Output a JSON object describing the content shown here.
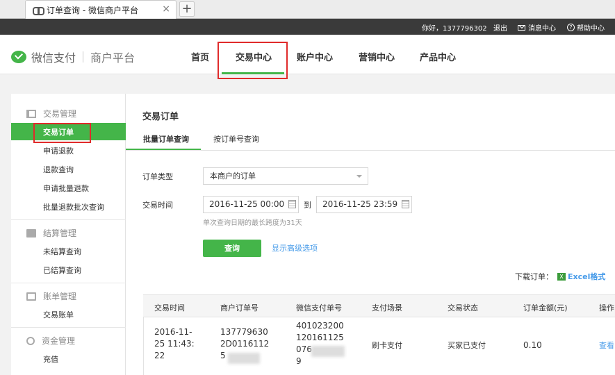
{
  "browser": {
    "tab_title": "订单查询 - 微信商户平台",
    "close_glyph": "×",
    "new_tab_glyph": "+"
  },
  "topbar": {
    "greeting": "你好，1377796302",
    "logout": "退出",
    "messages": "消息中心",
    "help": "帮助中心"
  },
  "header": {
    "brand": "微信支付",
    "platform": "商户平台",
    "nav": [
      "首页",
      "交易中心",
      "账户中心",
      "营销中心",
      "产品中心"
    ],
    "active_nav": "交易中心"
  },
  "sidebar": {
    "groups": [
      {
        "title": "交易管理",
        "items": [
          "交易订单",
          "申请退款",
          "退款查询",
          "申请批量退款",
          "批量退款批次查询"
        ]
      },
      {
        "title": "结算管理",
        "items": [
          "未结算查询",
          "已结算查询"
        ]
      },
      {
        "title": "账单管理",
        "items": [
          "交易账单"
        ]
      },
      {
        "title": "资金管理",
        "items": [
          "充值"
        ]
      }
    ],
    "active_item": "交易订单"
  },
  "main": {
    "title": "交易订单",
    "tabs": [
      "批量订单查询",
      "按订单号查询"
    ],
    "active_tab": "批量订单查询",
    "form": {
      "order_type_label": "订单类型",
      "order_type_value": "本商户的订单",
      "time_label": "交易时间",
      "start_time": "2016-11-25 00:00",
      "to_label": "到",
      "end_time": "2016-11-25 23:59",
      "hint": "单次查询日期的最长跨度为31天",
      "query_button": "查询",
      "advanced_link": "显示高级选项"
    },
    "download": {
      "label": "下载订单：",
      "icon_text": "X",
      "format": "Excel格式"
    },
    "table": {
      "columns": [
        "交易时间",
        "商户订单号",
        "微信支付单号",
        "支付场景",
        "交易状态",
        "订单金额(元)",
        "操作"
      ],
      "rows": [
        {
          "time_lines": [
            "2016-11-",
            "25 11:43:",
            "22"
          ],
          "merchant_order_lines": [
            "137779630",
            "2D0116112",
            "5"
          ],
          "wechat_order_lines": [
            "401023200",
            "120161125",
            "076",
            "9"
          ],
          "scene": "刷卡支付",
          "status": "买家已支付",
          "amount": "0.10",
          "action": "查看"
        }
      ]
    }
  }
}
